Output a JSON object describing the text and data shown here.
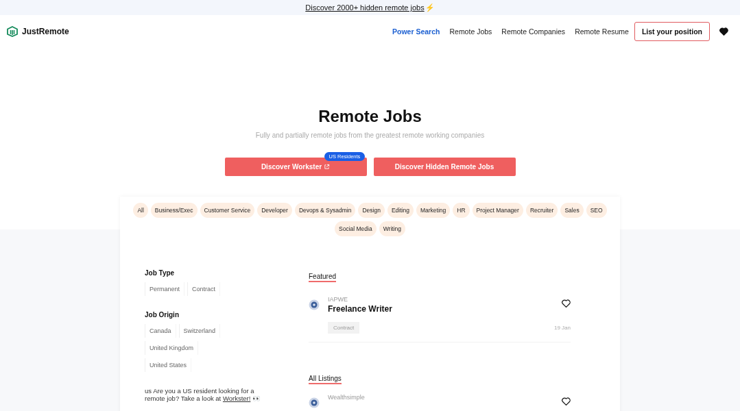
{
  "announcement": {
    "text": "Discover 2000+ hidden remote jobs",
    "icon": "⚡"
  },
  "brand": "JustRemote",
  "nav": [
    {
      "label": "Power Search",
      "selected": true
    },
    {
      "label": "Remote Jobs",
      "selected": false
    },
    {
      "label": "Remote Companies",
      "selected": false
    },
    {
      "label": "Remote Resume",
      "selected": false
    }
  ],
  "cta": "List your position",
  "hero": {
    "title": "Remote Jobs",
    "subtitle": "Fully and partially remote jobs from the greatest remote working companies"
  },
  "buttons": [
    {
      "label": "Discover Workster",
      "external": true,
      "badge": "US Residents"
    },
    {
      "label": "Discover Hidden Remote Jobs",
      "external": false
    }
  ],
  "categories": [
    "All",
    "Business/Exec",
    "Customer Service",
    "Developer",
    "Devops & Sysadmin",
    "Design",
    "Editing",
    "Marketing",
    "HR",
    "Project Manager",
    "Recruiter",
    "Sales",
    "SEO",
    "Social Media",
    "Writing"
  ],
  "filters": [
    {
      "title": "Job Type",
      "options": [
        "Permanent",
        "Contract"
      ]
    },
    {
      "title": "Job Origin",
      "options": [
        "Canada",
        "Switzerland",
        "United Kingdom",
        "United States"
      ]
    }
  ],
  "promo": {
    "flag": "us",
    "text": "Are you a US resident looking for a remote job? Take a look at",
    "link": "Workster!",
    "emoji": "👀"
  },
  "sections": [
    {
      "title": "Featured",
      "jobs": [
        {
          "company": "IAPWE",
          "title": "Freelance Writer",
          "tag": "Contract",
          "date": "19 Jan",
          "saved": false
        }
      ]
    },
    {
      "title": "All Listings",
      "jobs": [
        {
          "company": "Wealthsimple",
          "saved": false
        }
      ]
    }
  ]
}
